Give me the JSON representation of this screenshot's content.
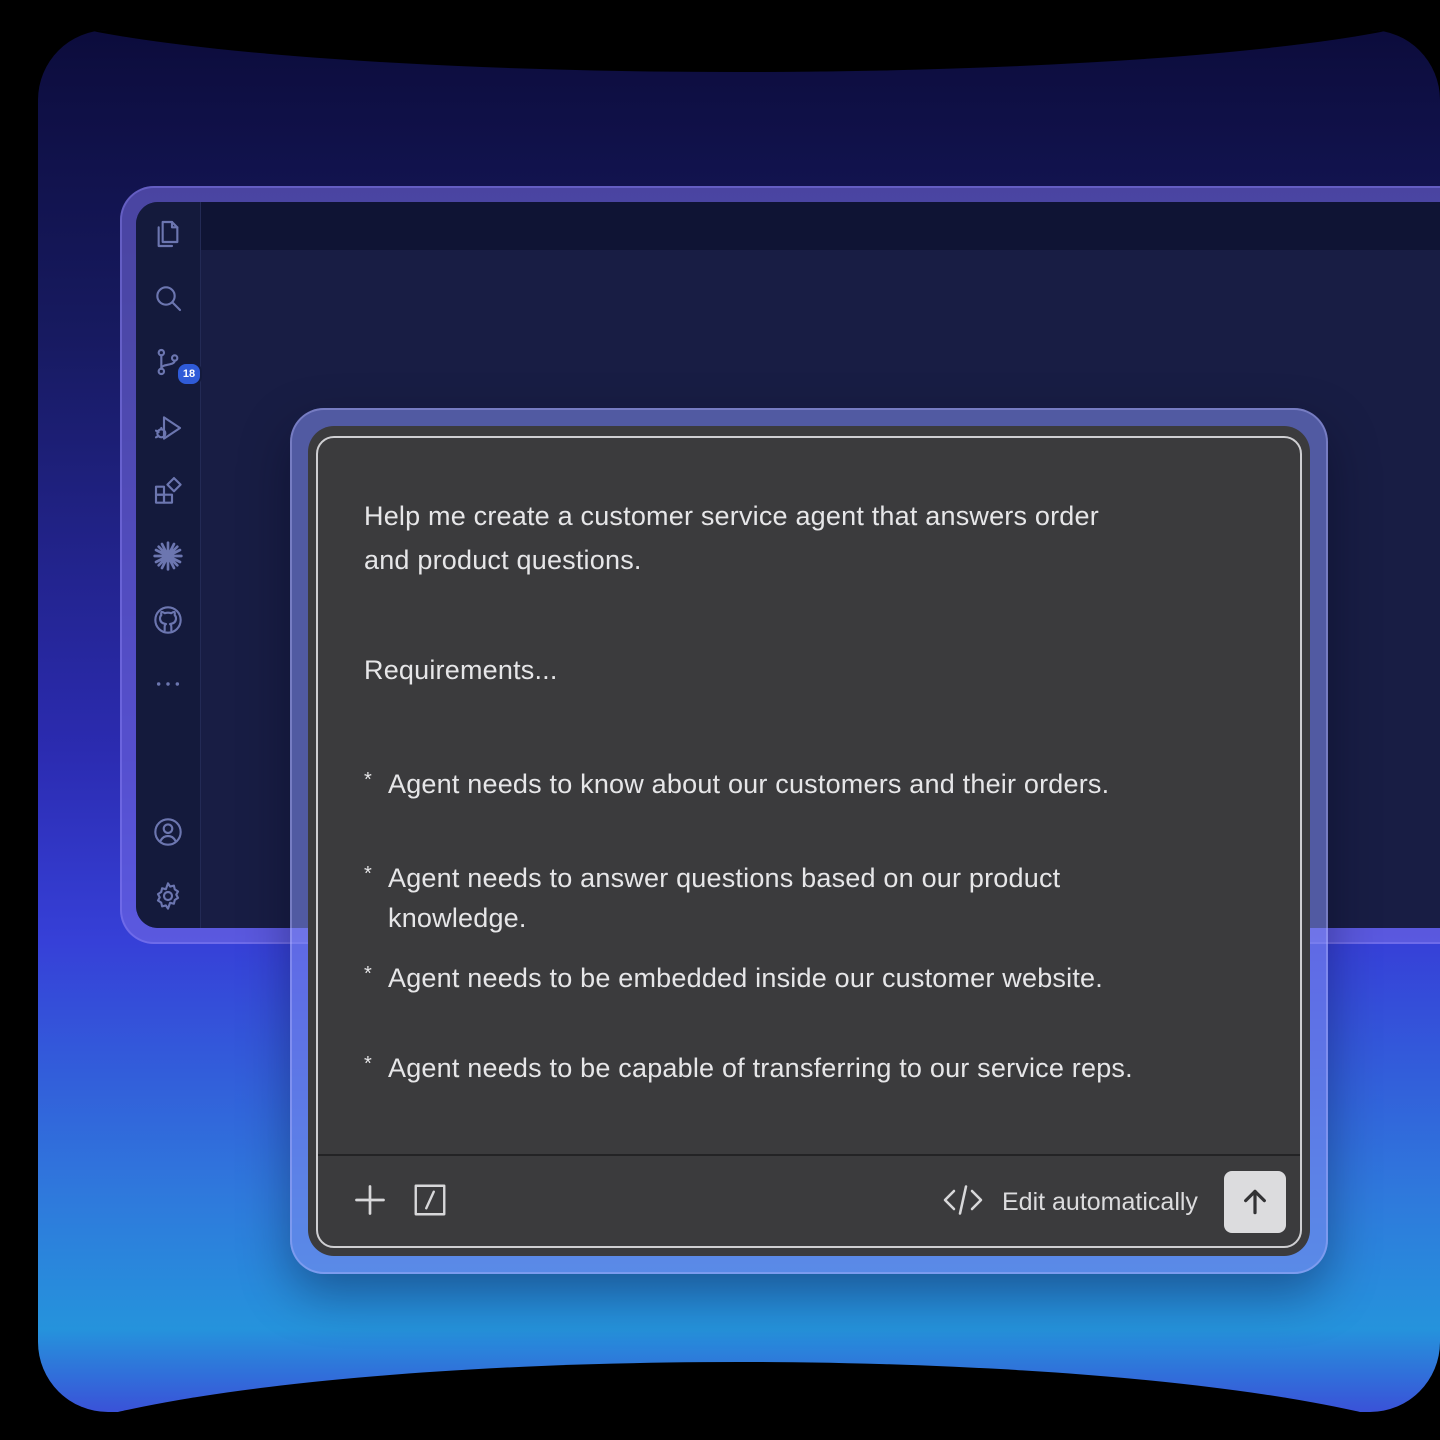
{
  "sidebar": {
    "icons": [
      {
        "name": "explorer-icon"
      },
      {
        "name": "search-icon"
      },
      {
        "name": "source-control-icon",
        "badge": "18"
      },
      {
        "name": "run-debug-icon"
      },
      {
        "name": "extensions-icon"
      },
      {
        "name": "sparkle-icon"
      },
      {
        "name": "github-icon"
      },
      {
        "name": "more-icon"
      },
      {
        "name": "account-icon"
      },
      {
        "name": "settings-gear-icon"
      }
    ]
  },
  "chat": {
    "prompt_line1": "Help me create a customer service agent that answers order",
    "prompt_line2": "and product questions.",
    "requirements_heading": "Requirements...",
    "bullet_symbol": "*",
    "requirements": [
      "Agent needs to know about our customers and their orders.",
      "Agent needs to answer questions based on our product knowledge.",
      "Agent needs to be embedded inside our customer website.",
      "Agent needs to be capable of transferring to our service reps."
    ]
  },
  "toolbar": {
    "add_icon": "plus-icon",
    "slash_icon": "slash-command-icon",
    "code_icon": "code-icon",
    "edit_mode_label": "Edit automatically",
    "send_icon": "arrow-up-icon"
  },
  "colors": {
    "chat_background": "#3b3b3d",
    "ide_background": "#181d44",
    "badge": "#2f5bd8"
  }
}
